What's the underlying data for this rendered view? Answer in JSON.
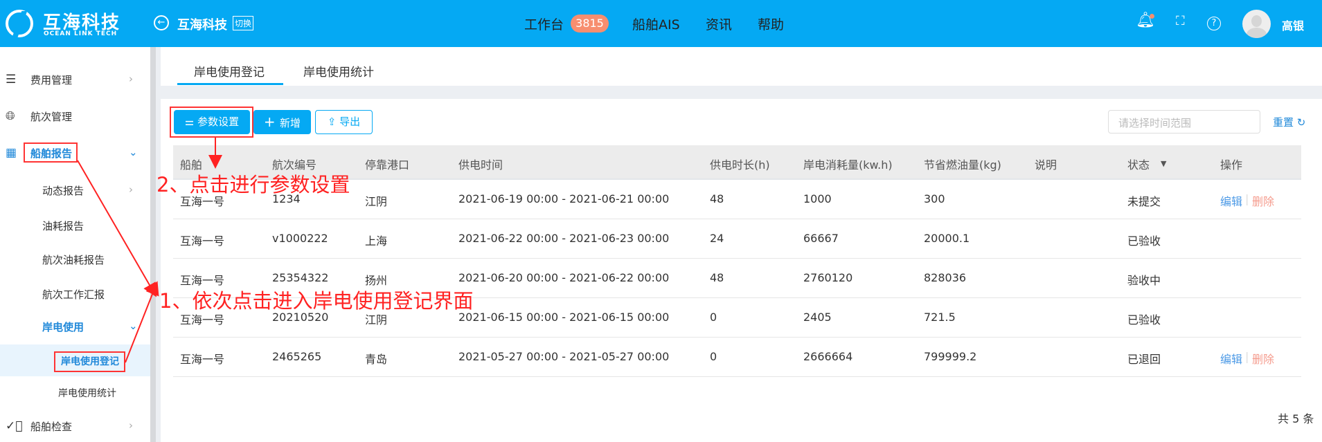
{
  "header": {
    "logo_title": "互海科技",
    "logo_sub": "OCEAN LINK TECH",
    "company": "互海科技",
    "switch_label": "切换",
    "nav": [
      {
        "label": "工作台",
        "badge": "3815"
      },
      {
        "label": "船舶AIS"
      },
      {
        "label": "资讯"
      },
      {
        "label": "帮助"
      }
    ],
    "user": "高银",
    "icons": [
      "bell-icon",
      "fullscreen-icon",
      "help-icon"
    ],
    "brand_color": "#05a9f3"
  },
  "sidebar": {
    "items": [
      {
        "label": "费用管理",
        "icon": "database-icon"
      },
      {
        "label": "航次管理",
        "icon": "globe-icon"
      },
      {
        "label": "船舶报告",
        "icon": "calendar-icon",
        "expanded": true
      },
      {
        "label": "动态报告"
      },
      {
        "label": "油耗报告"
      },
      {
        "label": "航次油耗报告"
      },
      {
        "label": "航次工作汇报"
      },
      {
        "label": "岸电使用",
        "expanded": true
      },
      {
        "label": "岸电使用登记",
        "selected": true
      },
      {
        "label": "岸电使用统计"
      },
      {
        "label": "船舶检查",
        "icon": "check-circle-icon"
      }
    ]
  },
  "tabs": [
    {
      "label": "岸电使用登记",
      "active": true
    },
    {
      "label": "岸电使用统计"
    }
  ],
  "toolbar": {
    "settings": "参数设置",
    "add": "新增",
    "export": "导出",
    "date_placeholder": "请选择时间范围",
    "reset": "重置"
  },
  "table": {
    "columns": [
      "船舶",
      "航次编号",
      "停靠港口",
      "供电时间",
      "供电时长(h)",
      "岸电消耗量(kw.h)",
      "节省燃油量(kg)",
      "说明",
      "状态",
      "操作"
    ],
    "rows": [
      [
        "互海一号",
        "1234",
        "江阴",
        "2021-06-19 00:00 - 2021-06-21 00:00",
        "48",
        "1000",
        "300",
        "",
        "未提交"
      ],
      [
        "互海一号",
        "v1000222",
        "上海",
        "2021-06-22 00:00 - 2021-06-23 00:00",
        "24",
        "66667",
        "20000.1",
        "",
        "已验收"
      ],
      [
        "互海一号",
        "25354322",
        "扬州",
        "2021-06-20 00:00 - 2021-06-22 00:00",
        "48",
        "2760120",
        "828036",
        "",
        "验收中"
      ],
      [
        "互海一号",
        "20210520",
        "江阴",
        "2021-06-15 00:00 - 2021-06-15 00:00",
        "0",
        "2405",
        "721.5",
        "",
        "已验收"
      ],
      [
        "互海一号",
        "2465265",
        "青岛",
        "2021-05-27 00:00 - 2021-05-27 00:00",
        "0",
        "2666664",
        "799999.2",
        "",
        "已退回"
      ]
    ],
    "actions": {
      "edit": "编辑",
      "delete": "删除"
    },
    "total": "共 5 条"
  },
  "annotations": {
    "step1": "1、依次点击进入岸电使用登记界面",
    "step2": "2、点击进行参数设置"
  }
}
